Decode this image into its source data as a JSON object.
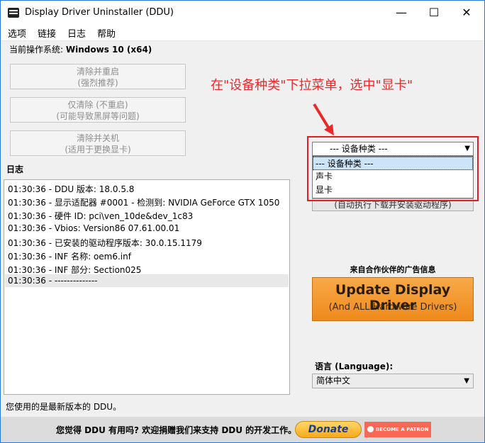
{
  "window": {
    "title": "Display Driver Uninstaller (DDU)",
    "minimize": "—",
    "maximize": "☐",
    "close": "✕"
  },
  "menu": [
    "选项",
    "链接",
    "日志",
    "帮助"
  ],
  "os": {
    "label": "当前操作系统:",
    "value": "Windows 10 (x64)"
  },
  "buttons": [
    {
      "line1": "清除并重启",
      "line2": "(强烈推荐)"
    },
    {
      "line1": "仅清除 (不重启)",
      "line2": "(可能导致黑屏等问题)"
    },
    {
      "line1": "清除并关机",
      "line2": "(适用于更换显卡)"
    }
  ],
  "log": {
    "label": "日志",
    "lines": [
      "01:30:36 - DDU 版本: 18.0.5.8",
      "01:30:36 - 显示适配器 #0001 - 检测到: NVIDIA GeForce GTX 1050",
      "01:30:36 - 硬件 ID: pci\\ven_10de&dev_1c83",
      "01:30:36 - Vbios: Version86 07.61.00.01",
      "01:30:36 - 已安装的驱动程序版本: 30.0.15.1179",
      "01:30:36 - INF 名称: oem6.inf",
      "01:30:36 - INF 部分: Section025",
      "01:30:36 - --------------"
    ]
  },
  "annotation": {
    "text": "在\"设备种类\"下拉菜单，选中\"显卡\"",
    "color": "#ea2a2a"
  },
  "device_dropdown": {
    "selected": "--- 设备种类 ---",
    "options": [
      "--- 设备种类 ---",
      "声卡",
      "显卡"
    ],
    "highlighted_index": 0
  },
  "partial_button": "(自动执行下载并安装驱动程序)",
  "ad": {
    "label": "来自合作伙伴的广告信息",
    "main": "Update Display Driver",
    "sub": "(And ALL Hardware Drivers)"
  },
  "language": {
    "label": "语言 (Language):",
    "value": "简体中文"
  },
  "status": "您使用的是最新版本的 DDU。",
  "footer": {
    "text": "您觉得 DDU 有用吗? 欢迎捐赠我们来支持 DDU 的开发工作。",
    "donate": "Donate",
    "patron": "BECOME A PATRON"
  }
}
